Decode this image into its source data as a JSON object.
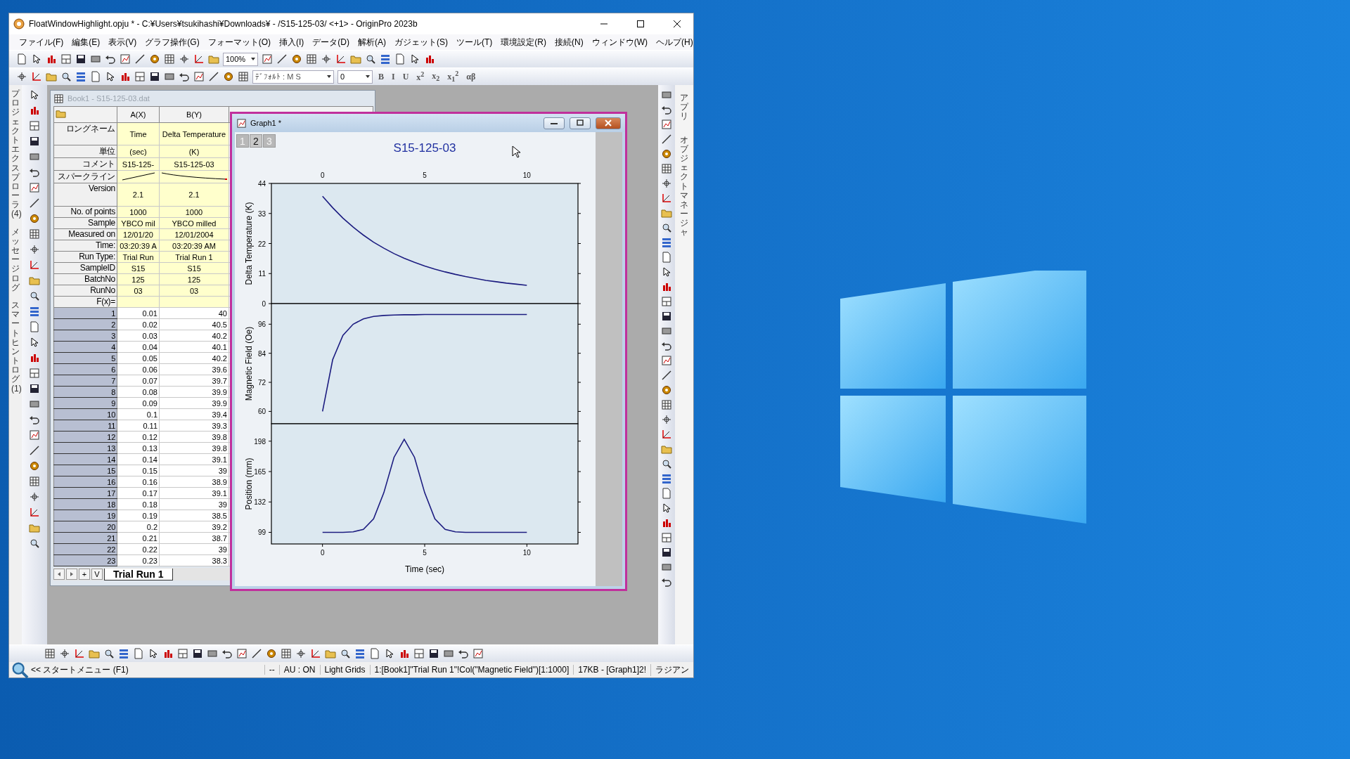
{
  "app_window": {
    "title": "FloatWindowHighlight.opju * - C:¥Users¥tsukihashi¥Downloads¥ - /S15-125-03/ <+1> - OriginPro 2023b"
  },
  "menu": [
    "ファイル(F)",
    "編集(E)",
    "表示(V)",
    "グラフ操作(G)",
    "フォーマット(O)",
    "挿入(I)",
    "データ(D)",
    "解析(A)",
    "ガジェット(S)",
    "ツール(T)",
    "環境設定(R)",
    "接続(N)",
    "ウィンドウ(W)",
    "ヘルプ(H)"
  ],
  "toolbar": {
    "zoom": "100%",
    "font": "ﾃﾞﾌｫﾙﾄ : M S",
    "font_size": "0",
    "format_buttons": [
      "B",
      "I",
      "U",
      "x$^{2}$",
      "x$_{2}$",
      "x$_{1}$$^{2}$",
      "αβ"
    ]
  },
  "left_dock": [
    "プロジェクトエクスプローラ (4)",
    "メッセージログ",
    "スマートヒントログ (1)"
  ],
  "right_dock": [
    "アプリ",
    "オブジェクトマネージャ"
  ],
  "book": {
    "title": "Book1 - S15-125-03.dat",
    "columns": [
      "",
      "A(X)",
      "B(Y)"
    ],
    "label_rows": [
      {
        "label": "ロングネーム",
        "kind": "text",
        "values": [
          "Time",
          "Delta Temperature"
        ]
      },
      {
        "label": "単位",
        "kind": "text",
        "values": [
          "(sec)",
          "(K)"
        ]
      },
      {
        "label": "コメント",
        "kind": "text",
        "values": [
          "S15-125-",
          "S15-125-03"
        ]
      },
      {
        "label": "スパークライン",
        "kind": "sparkline"
      },
      {
        "label": "Version",
        "kind": "text",
        "values": [
          "2.1",
          "2.1"
        ]
      },
      {
        "label": "No. of points",
        "kind": "text",
        "values": [
          "1000",
          "1000"
        ]
      },
      {
        "label": "Sample",
        "kind": "text",
        "values": [
          "YBCO mil",
          "YBCO milled"
        ]
      },
      {
        "label": "Measured on",
        "kind": "text",
        "values": [
          "12/01/20",
          "12/01/2004"
        ]
      },
      {
        "label": "Time:",
        "kind": "text",
        "values": [
          "03:20:39 A",
          "03:20:39 AM"
        ]
      },
      {
        "label": "Run Type:",
        "kind": "text",
        "values": [
          "Trial Run",
          "Trial Run 1"
        ]
      },
      {
        "label": "SampleID",
        "kind": "text",
        "values": [
          "S15",
          "S15"
        ]
      },
      {
        "label": "BatchNo",
        "kind": "text",
        "values": [
          "125",
          "125"
        ]
      },
      {
        "label": "RunNo",
        "kind": "text",
        "values": [
          "03",
          "03"
        ]
      },
      {
        "label": "F(x)=",
        "kind": "blank"
      }
    ],
    "rows": [
      [
        "1",
        "0.01",
        "40"
      ],
      [
        "2",
        "0.02",
        "40.5"
      ],
      [
        "3",
        "0.03",
        "40.2"
      ],
      [
        "4",
        "0.04",
        "40.1"
      ],
      [
        "5",
        "0.05",
        "40.2"
      ],
      [
        "6",
        "0.06",
        "39.6"
      ],
      [
        "7",
        "0.07",
        "39.7"
      ],
      [
        "8",
        "0.08",
        "39.9"
      ],
      [
        "9",
        "0.09",
        "39.9"
      ],
      [
        "10",
        "0.1",
        "39.4"
      ],
      [
        "11",
        "0.11",
        "39.3"
      ],
      [
        "12",
        "0.12",
        "39.8"
      ],
      [
        "13",
        "0.13",
        "39.8"
      ],
      [
        "14",
        "0.14",
        "39.1"
      ],
      [
        "15",
        "0.15",
        "39"
      ],
      [
        "16",
        "0.16",
        "38.9"
      ],
      [
        "17",
        "0.17",
        "39.1"
      ],
      [
        "18",
        "0.18",
        "39"
      ],
      [
        "19",
        "0.19",
        "38.5"
      ],
      [
        "20",
        "0.2",
        "39.2"
      ],
      [
        "21",
        "0.21",
        "38.7"
      ],
      [
        "22",
        "0.22",
        "39"
      ],
      [
        "23",
        "0.23",
        "38.3"
      ]
    ],
    "sheet_nav": [
      "+",
      "V"
    ],
    "sheet_tabs": [
      {
        "label": "Trial Run 1",
        "selected": true
      }
    ]
  },
  "graph": {
    "title": "Graph1 *",
    "layers": [
      {
        "label": "1",
        "selected": false
      },
      {
        "label": "2",
        "selected": true
      },
      {
        "label": "3",
        "selected": false
      }
    ],
    "plot_title": "S15-125-03",
    "panels": [
      {
        "chart_data": {
          "type": "line",
          "ylabel": "Delta Temperature (K)",
          "xlim": [
            -2.5,
            12.5
          ],
          "ylim": [
            0,
            44
          ],
          "xticks": [
            0,
            5,
            10
          ],
          "yticks": [
            0,
            11,
            22,
            33,
            44
          ],
          "x": [
            0,
            0.5,
            1,
            1.5,
            2,
            2.5,
            3,
            3.5,
            4,
            4.5,
            5,
            5.5,
            6,
            6.5,
            7,
            7.5,
            8,
            8.5,
            9,
            9.5,
            10
          ],
          "series": [
            {
              "color": "#1c1c80",
              "values": [
                39.3,
                35.1,
                31.3,
                28.0,
                25.1,
                22.5,
                20.3,
                18.3,
                16.6,
                15.1,
                13.8,
                12.6,
                11.6,
                10.7,
                9.9,
                9.2,
                8.5,
                8.0,
                7.5,
                7.1,
                6.7
              ]
            }
          ]
        }
      },
      {
        "chart_data": {
          "type": "line",
          "ylabel": "Magnetic Field (Oe)",
          "xlim": [
            -2.5,
            12.5
          ],
          "ylim": [
            54.9,
            104.5
          ],
          "yticks": [
            60,
            72,
            84,
            96
          ],
          "x": [
            0,
            0.5,
            1,
            1.5,
            2,
            2.5,
            3,
            3.5,
            4,
            4.5,
            5,
            5.5,
            6,
            6.5,
            7,
            7.5,
            8,
            8.5,
            9,
            9.5,
            10
          ],
          "series": [
            {
              "color": "#1c1c80",
              "values": [
                60,
                81.4,
                91.4,
                96.0,
                98.2,
                99.2,
                99.6,
                99.8,
                99.9,
                99.9,
                100,
                100,
                100,
                100,
                100,
                100,
                100,
                100,
                100,
                100,
                100
              ]
            }
          ]
        }
      },
      {
        "chart_data": {
          "type": "line",
          "xlabel": "Time (sec)",
          "ylabel": "Position (mm)",
          "xlim": [
            -2.5,
            12.5
          ],
          "ylim": [
            86.4,
            216.9
          ],
          "xticks": [
            0,
            5,
            10
          ],
          "yticks": [
            99,
            132,
            165,
            198
          ],
          "x": [
            0,
            0.5,
            1,
            1.5,
            2,
            2.5,
            3,
            3.5,
            4,
            4.5,
            5,
            5.5,
            6,
            6.5,
            7,
            7.5,
            8,
            8.5,
            9,
            9.5,
            10
          ],
          "series": [
            {
              "color": "#1c1c80",
              "values": [
                99,
                99,
                99,
                99.5,
                102.3,
                113.6,
                142,
                180.5,
                200,
                180.5,
                142,
                113.6,
                102.3,
                99.5,
                99,
                99,
                99,
                99,
                99,
                99,
                99
              ]
            }
          ]
        }
      }
    ]
  },
  "status_bar": {
    "start": "<< スタートメニュー (F1)",
    "items": [
      "--",
      "AU : ON",
      "Light Grids",
      "1:[Book1]\"Trial Run 1\"!Col(\"Magnetic Field\")[1:1000]",
      "17KB - [Graph1]2!",
      "ラジアン"
    ]
  }
}
